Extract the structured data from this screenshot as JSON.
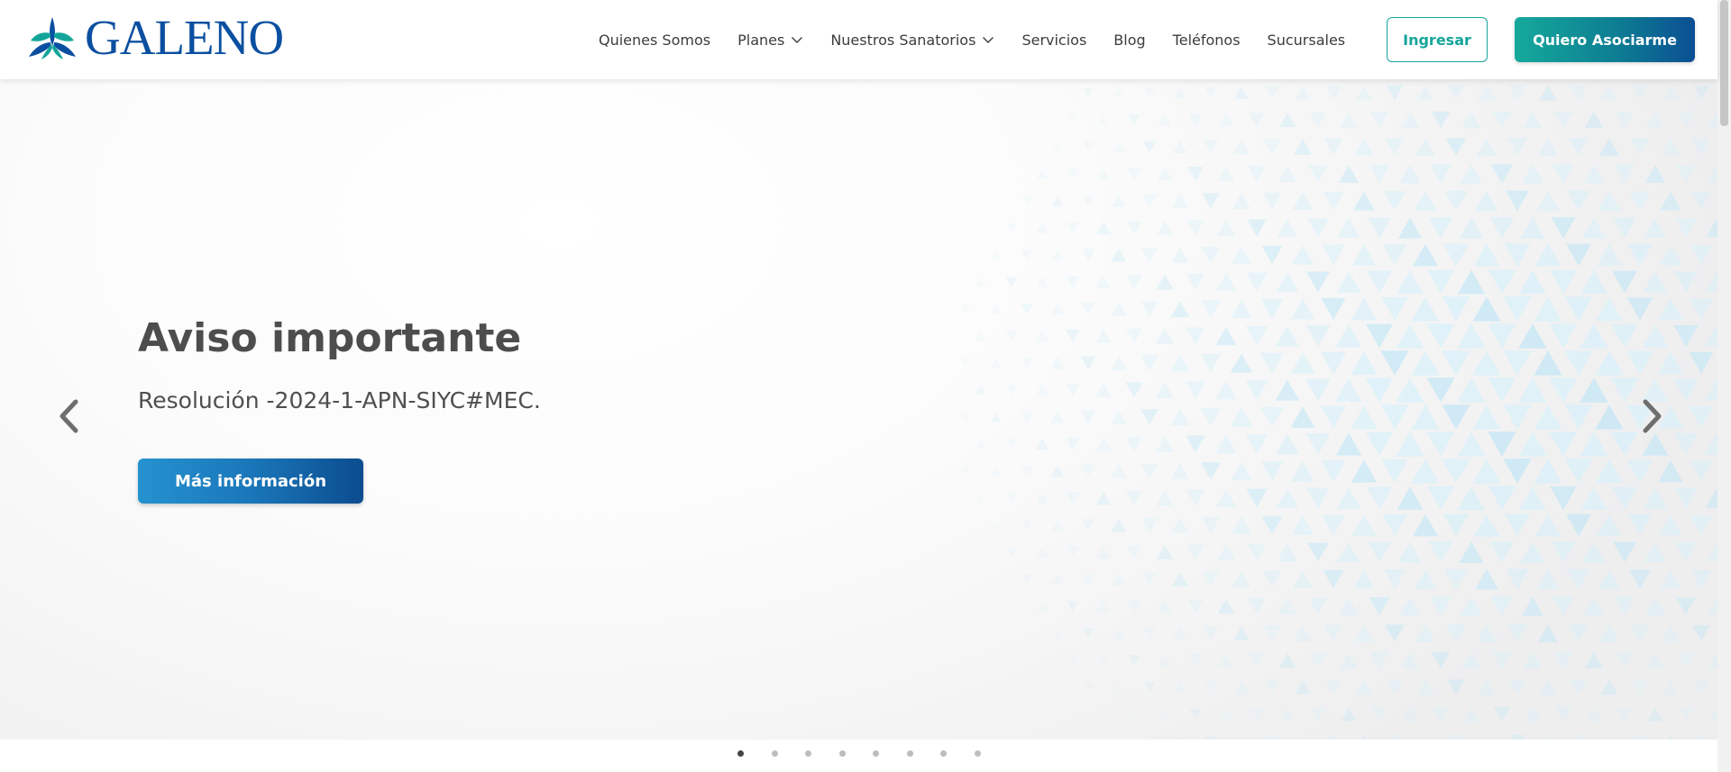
{
  "brand": {
    "name": "GALENO",
    "logo_icon": "galeno-leaf-icon",
    "primary_color": "#0b4fa0",
    "accent_color": "#14a59a"
  },
  "nav": {
    "items": [
      {
        "label": "Quienes Somos",
        "has_dropdown": false
      },
      {
        "label": "Planes",
        "has_dropdown": true
      },
      {
        "label": "Nuestros Sanatorios",
        "has_dropdown": true
      },
      {
        "label": "Servicios",
        "has_dropdown": false
      },
      {
        "label": "Blog",
        "has_dropdown": false
      },
      {
        "label": "Teléfonos",
        "has_dropdown": false
      },
      {
        "label": "Sucursales",
        "has_dropdown": false
      }
    ],
    "login_label": "Ingresar",
    "join_label": "Quiero Asociarme"
  },
  "hero": {
    "title": "Aviso importante",
    "subtitle": "Resolución -2024-1-APN-SIYC#MEC.",
    "cta_label": "Más información",
    "prev_icon": "chevron-left-icon",
    "next_icon": "chevron-right-icon"
  },
  "carousel": {
    "slide_count": 8,
    "active_index": 0
  }
}
